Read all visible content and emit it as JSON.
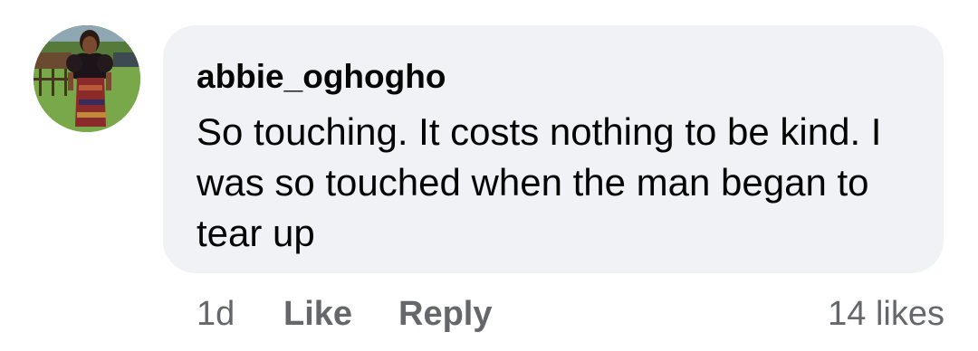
{
  "comment": {
    "author": "abbie_oghogho",
    "text": "So touching. It costs nothing to be kind. I was so touched when the man began to tear up",
    "time": "1d",
    "like_label": "Like",
    "reply_label": "Reply",
    "likes_count": "14 likes",
    "avatar_icon": "profile-photo"
  },
  "colors": {
    "bubble_background": "#f0f2f5",
    "text": "#050505",
    "secondary_text": "#65676b"
  }
}
